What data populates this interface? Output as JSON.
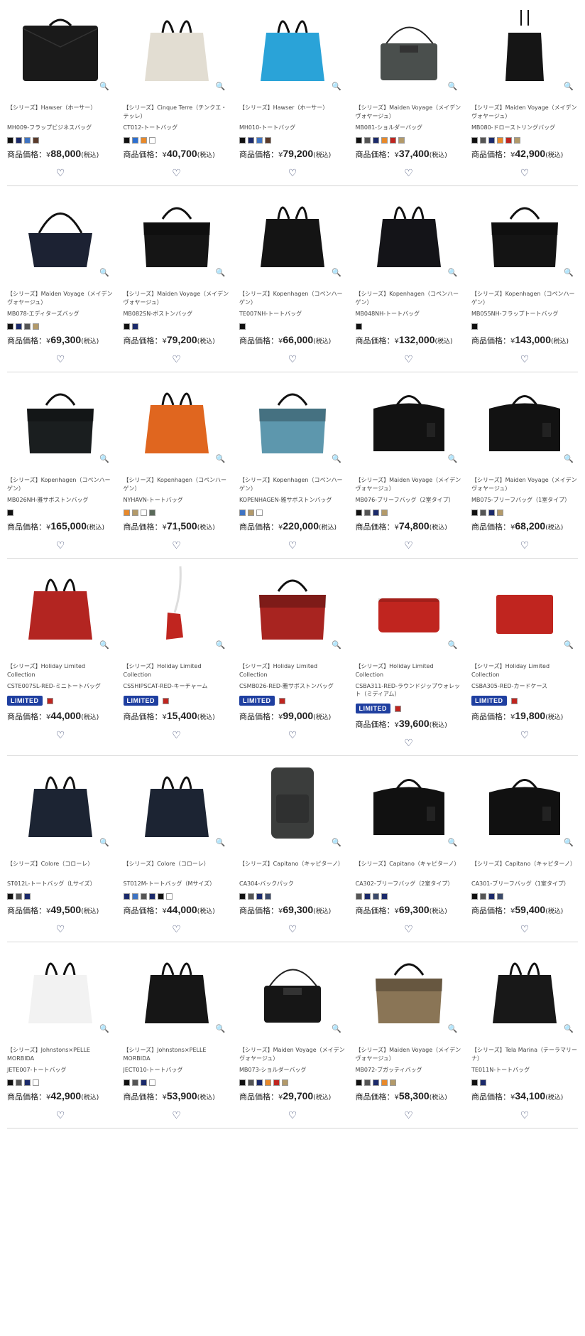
{
  "price_label": "商品価格：",
  "yen": "¥",
  "tax": "(税込)",
  "zoom_icon": "🔍",
  "heart_icon": "♡",
  "rows": [
    [
      {
        "series": "【シリーズ】Hawser（ホーサー）",
        "model": "MH009-フラップビジネスバッグ",
        "colors": [
          "#111111",
          "#1b2a6b",
          "#3e74c4",
          "#5a3a2a"
        ],
        "price": "88,000",
        "shape": "briefcase",
        "bag": "#1a1a1a",
        "limited": false
      },
      {
        "series": "【シリーズ】Cinque Terre（チンクエ・テッレ）",
        "model": "CT012-トートバッグ",
        "colors": [
          "#111111",
          "#2d6fd0",
          "#e8892a",
          "#ffffff"
        ],
        "price": "40,700",
        "shape": "tote",
        "bag": "#e2ddd2",
        "limited": false
      },
      {
        "series": "【シリーズ】Hawser（ホーサー）",
        "model": "MH010-トートバッグ",
        "colors": [
          "#111111",
          "#1b2a6b",
          "#3e74c4",
          "#5a3a2a"
        ],
        "price": "79,200",
        "shape": "tote",
        "bag": "#2aa3d8",
        "limited": false
      },
      {
        "series": "【シリーズ】Maiden Voyage（メイデンヴォヤージュ）",
        "model": "MB081-ショルダーバッグ",
        "colors": [
          "#111111",
          "#555555",
          "#1b2a6b",
          "#e8892a",
          "#c0251f",
          "#b39a6a"
        ],
        "price": "37,400",
        "shape": "shoulder",
        "bag": "#4a4f4d",
        "limited": false
      },
      {
        "series": "【シリーズ】Maiden Voyage（メイデンヴォヤージュ）",
        "model": "MB080-ドローストリングバッグ",
        "colors": [
          "#111111",
          "#555555",
          "#1b2a6b",
          "#e8892a",
          "#c0251f",
          "#b39a6a"
        ],
        "price": "42,900",
        "shape": "pouch",
        "bag": "#151515",
        "limited": false
      }
    ],
    [
      {
        "series": "【シリーズ】Maiden Voyage（メイデンヴォヤージュ）",
        "model": "MB078-エディターズバッグ",
        "colors": [
          "#111111",
          "#1b2a6b",
          "#555555",
          "#b39a6a"
        ],
        "price": "69,300",
        "shape": "hobo",
        "bag": "#1c2233",
        "limited": false
      },
      {
        "series": "【シリーズ】Maiden Voyage（メイデンヴォヤージュ）",
        "model": "MB082SN-ボストンバッグ",
        "colors": [
          "#111111",
          "#1b2a6b"
        ],
        "price": "79,200",
        "shape": "boston",
        "bag": "#151515",
        "limited": false
      },
      {
        "series": "【シリーズ】Kopenhagen（コペンハーゲン）",
        "model": "TE007NH-トートバッグ",
        "colors": [
          "#111111"
        ],
        "price": "66,000",
        "shape": "tote",
        "bag": "#141414",
        "limited": false
      },
      {
        "series": "【シリーズ】Kopenhagen（コペンハーゲン）",
        "model": "MB048NH-トートバッグ",
        "colors": [
          "#111111"
        ],
        "price": "132,000",
        "shape": "tote",
        "bag": "#141418",
        "limited": false
      },
      {
        "series": "【シリーズ】Kopenhagen（コペンハーゲン）",
        "model": "MB055NH-フラップトートバッグ",
        "colors": [
          "#111111"
        ],
        "price": "143,000",
        "shape": "boston",
        "bag": "#141414",
        "limited": false
      }
    ],
    [
      {
        "series": "【シリーズ】Kopenhagen（コペンハーゲン）",
        "model": "MB026NH-雅サボストンバッグ",
        "colors": [
          "#111111"
        ],
        "price": "165,000",
        "shape": "boston",
        "bag": "#1a1e1f",
        "limited": false
      },
      {
        "series": "【シリーズ】Kopenhagen（コペンハーゲン）",
        "model": "NYHAVN-トートバッグ",
        "colors": [
          "#e8892a",
          "#b39a6a",
          "#ffffff",
          "#5a6a5a"
        ],
        "price": "71,500",
        "shape": "tote",
        "bag": "#e0661f",
        "limited": false
      },
      {
        "series": "【シリーズ】Kopenhagen（コペンハーゲン）",
        "model": "KOPENHAGEN-雅サボストンバッグ",
        "colors": [
          "#3e74c4",
          "#b39a6a",
          "#ffffff"
        ],
        "price": "220,000",
        "shape": "boston",
        "bag": "#5d97ad",
        "limited": false
      },
      {
        "series": "【シリーズ】Maiden Voyage（メイデンヴォヤージュ）",
        "model": "MB076-ブリーフバッグ（2室タイプ）",
        "colors": [
          "#111111",
          "#555555",
          "#1b2a6b",
          "#b39a6a"
        ],
        "price": "74,800",
        "shape": "brief",
        "bag": "#121212",
        "limited": false
      },
      {
        "series": "【シリーズ】Maiden Voyage（メイデンヴォヤージュ）",
        "model": "MB075-ブリーフバッグ（1室タイプ）",
        "colors": [
          "#111111",
          "#555555",
          "#1b2a6b",
          "#b39a6a"
        ],
        "price": "68,200",
        "shape": "brief",
        "bag": "#121212",
        "limited": false
      }
    ],
    [
      {
        "series": "【シリーズ】Holiday Limited Collection",
        "model": "CSTE007SL-RED-ミニトートバッグ",
        "colors": [
          "#c0251f"
        ],
        "price": "44,000",
        "shape": "tote",
        "bag": "#b32521",
        "limited": true
      },
      {
        "series": "【シリーズ】Holiday Limited Collection",
        "model": "CSSHIPSCAT-RED-キーチャーム",
        "colors": [
          "#c0251f"
        ],
        "price": "15,400",
        "shape": "charm",
        "bag": "#c0251f",
        "limited": true
      },
      {
        "series": "【シリーズ】Holiday Limited Collection",
        "model": "CSMB026-RED-雅サボストンバッグ",
        "colors": [
          "#c0251f"
        ],
        "price": "99,000",
        "shape": "boston",
        "bag": "#a82420",
        "limited": true
      },
      {
        "series": "【シリーズ】Holiday Limited Collection",
        "model": "CSBA311-RED-ラウンドジップウォレット（ミディアム）",
        "colors": [
          "#c0251f"
        ],
        "price": "39,600",
        "shape": "wallet",
        "bag": "#c0251f",
        "limited": true
      },
      {
        "series": "【シリーズ】Holiday Limited Collection",
        "model": "CSBA305-RED-カードケース",
        "colors": [
          "#c0251f"
        ],
        "price": "19,800",
        "shape": "card",
        "bag": "#c0251f",
        "limited": true
      }
    ],
    [
      {
        "series": "【シリーズ】Colore（コローレ）",
        "model": "ST012L-トートバッグ（Lサイズ）",
        "colors": [
          "#111111",
          "#555555",
          "#1b2a6b"
        ],
        "price": "49,500",
        "shape": "tote",
        "bag": "#1c2433",
        "limited": false
      },
      {
        "series": "【シリーズ】Colore（コローレ）",
        "model": "ST012M-トートバッグ（Mサイズ）",
        "colors": [
          "#1b2a6b",
          "#3e74c4",
          "#555555",
          "#1b2a6b",
          "#111111",
          "#ffffff"
        ],
        "price": "44,000",
        "shape": "tote",
        "bag": "#1c2433",
        "limited": false
      },
      {
        "series": "【シリーズ】Capitano（キャピターノ）",
        "model": "CA304-バックパック",
        "colors": [
          "#111111",
          "#555555",
          "#1b2a6b",
          "#3b4a6a"
        ],
        "price": "69,300",
        "shape": "backpack",
        "bag": "#3b3d3c",
        "limited": false
      },
      {
        "series": "【シリーズ】Capitano（キャピターノ）",
        "model": "CA302-ブリーフバッグ（2室タイプ）",
        "colors": [
          "#555555",
          "#1b2a6b",
          "#3b4a6a",
          "#1b2a6b"
        ],
        "price": "69,300",
        "shape": "brief",
        "bag": "#111111",
        "limited": false
      },
      {
        "series": "【シリーズ】Capitano（キャピターノ）",
        "model": "CA301-ブリーフバッグ（1室タイプ）",
        "colors": [
          "#111111",
          "#555555",
          "#1b2a6b",
          "#3b4a6a"
        ],
        "price": "59,400",
        "shape": "brief",
        "bag": "#111111",
        "limited": false
      }
    ],
    [
      {
        "series": "【シリーズ】Johnstons×PELLE MORBIDA",
        "model": "JETE007-トートバッグ",
        "colors": [
          "#111111",
          "#555555",
          "#1b2a6b",
          "#ffffff"
        ],
        "price": "42,900",
        "shape": "tote",
        "bag": "#f2f2f2",
        "limited": false
      },
      {
        "series": "【シリーズ】Johnstons×PELLE MORBIDA",
        "model": "JECT010-トートバッグ",
        "colors": [
          "#111111",
          "#555555",
          "#1b2a6b",
          "#ffffff"
        ],
        "price": "53,900",
        "shape": "tote",
        "bag": "#161616",
        "limited": false
      },
      {
        "series": "【シリーズ】Maiden Voyage（メイデンヴォヤージュ）",
        "model": "MB073-ショルダーバッグ",
        "colors": [
          "#111111",
          "#555555",
          "#1b2a6b",
          "#e8892a",
          "#c0251f",
          "#b39a6a"
        ],
        "price": "29,700",
        "shape": "shoulder",
        "bag": "#161616",
        "limited": false
      },
      {
        "series": "【シリーズ】Maiden Voyage（メイデンヴォヤージュ）",
        "model": "MB072-ブガッティバッグ",
        "colors": [
          "#111111",
          "#555555",
          "#1b2a6b",
          "#e8892a",
          "#b39a6a"
        ],
        "price": "58,300",
        "shape": "boston",
        "bag": "#8a7556",
        "limited": false
      },
      {
        "series": "【シリーズ】Tela Marina（テーラマリーナ）",
        "model": "TE011N-トートバッグ",
        "colors": [
          "#111111",
          "#1b2a6b"
        ],
        "price": "34,100",
        "shape": "tote",
        "bag": "#181818",
        "limited": false
      }
    ]
  ]
}
